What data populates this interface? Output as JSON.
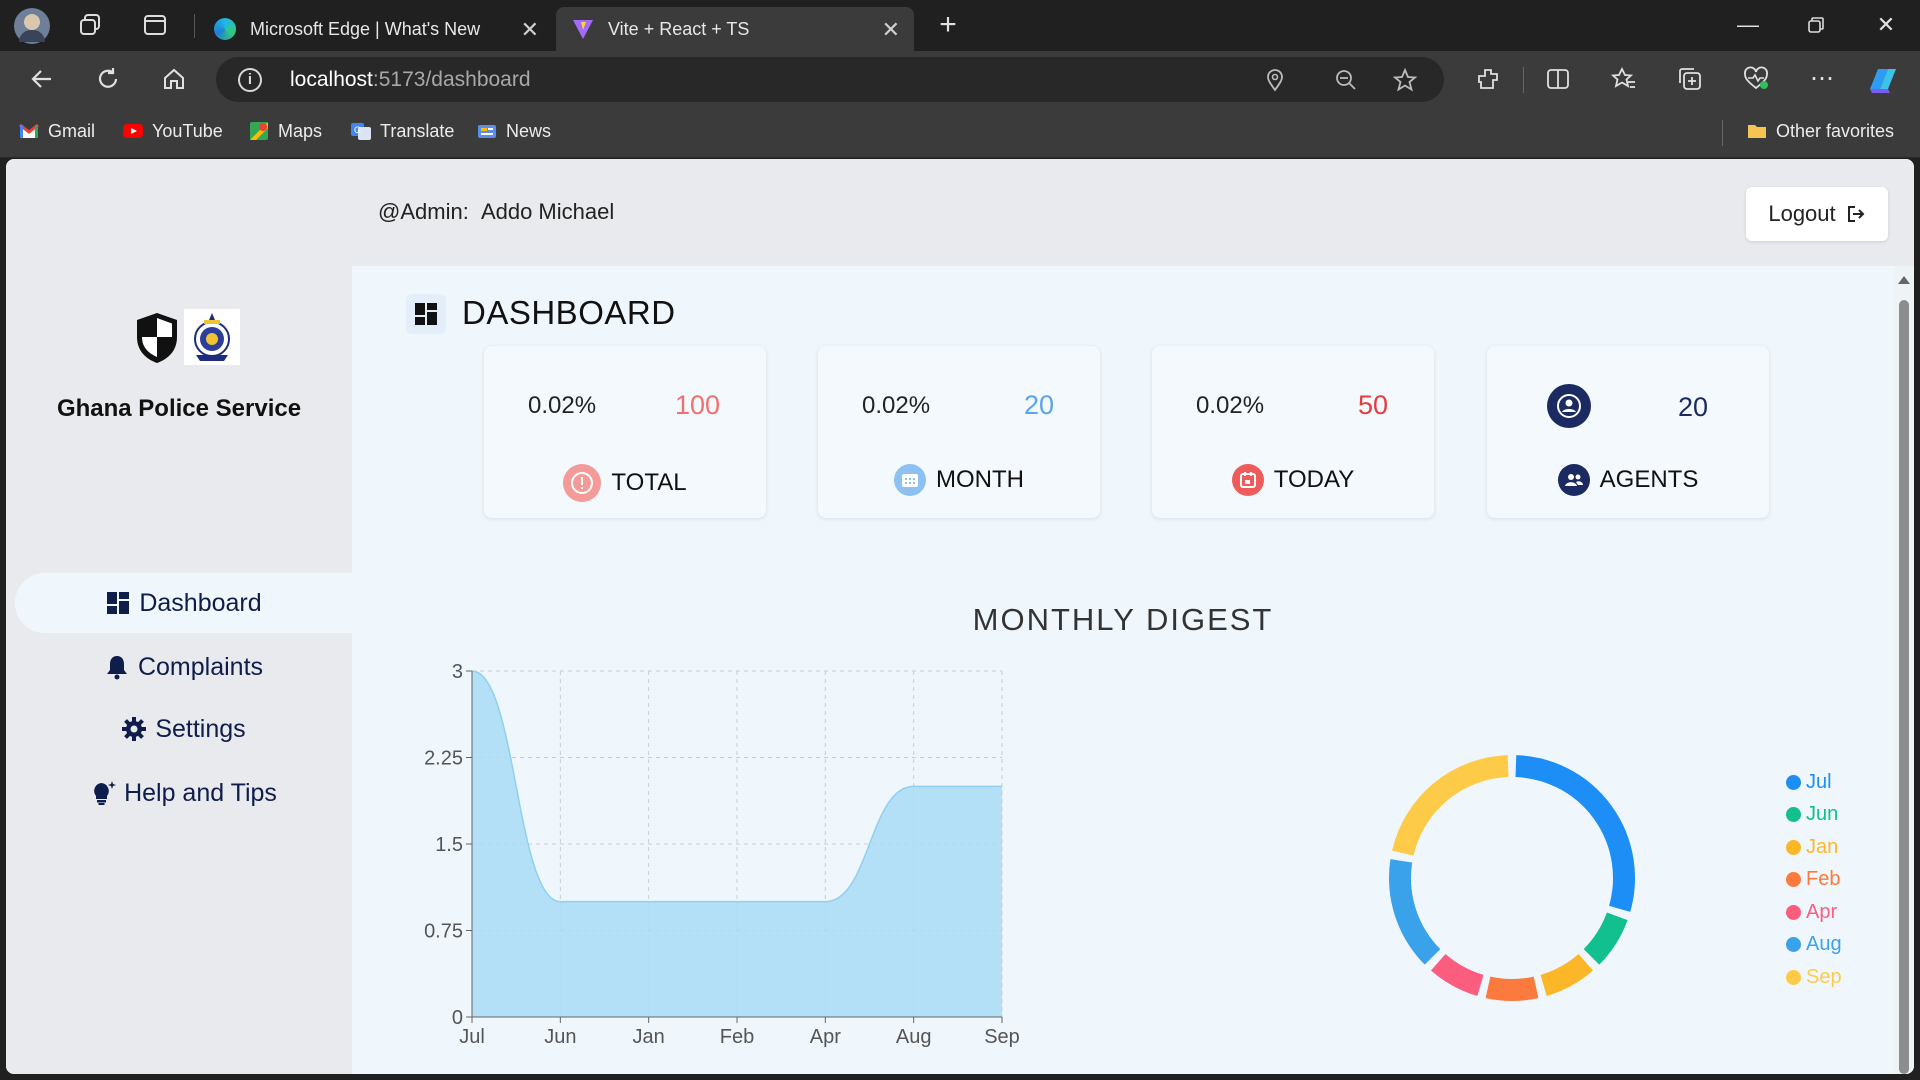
{
  "browser": {
    "tabs": [
      {
        "title": "Microsoft Edge | What's New",
        "active": false
      },
      {
        "title": "Vite + React + TS",
        "active": true
      }
    ],
    "address": {
      "host": "localhost",
      "path": ":5173/dashboard"
    },
    "favorites": [
      {
        "label": "Gmail",
        "icon": "gmail-icon",
        "color": "#ea4335"
      },
      {
        "label": "YouTube",
        "icon": "youtube-icon",
        "color": "#ff0000"
      },
      {
        "label": "Maps",
        "icon": "maps-icon",
        "color": "#34a853"
      },
      {
        "label": "Translate",
        "icon": "translate-icon",
        "color": "#4285f4"
      },
      {
        "label": "News",
        "icon": "news-icon",
        "color": "#5b8def"
      }
    ],
    "other_favorites": "Other favorites"
  },
  "sidebar": {
    "org_name": "Ghana Police Service",
    "items": [
      {
        "label": "Dashboard",
        "icon": "dashboard-icon",
        "active": true
      },
      {
        "label": "Complaints",
        "icon": "bell-icon",
        "active": false
      },
      {
        "label": "Settings",
        "icon": "gear-icon",
        "active": false
      },
      {
        "label": "Help and Tips",
        "icon": "lightbulb-icon",
        "active": false
      }
    ]
  },
  "topbar": {
    "admin_prefix": "@Admin:",
    "admin_name": "Addo Michael",
    "logout_label": "Logout"
  },
  "dashboard": {
    "title": "DASHBOARD",
    "cards": [
      {
        "percent": "0.02%",
        "count": "100",
        "label": "TOTAL",
        "icon": "alert-circle-icon",
        "count_color": "#f0706e",
        "icon_bg": "#f49a98"
      },
      {
        "percent": "0.02%",
        "count": "20",
        "label": "MONTH",
        "icon": "calendar-icon",
        "count_color": "#5aa4ea",
        "icon_bg": "#8ec1f2"
      },
      {
        "percent": "0.02%",
        "count": "50",
        "label": "TODAY",
        "icon": "calendar-day-icon",
        "count_color": "#e43c3c",
        "icon_bg": "#ef5a5a"
      },
      {
        "percent": "",
        "count": "20",
        "label": "AGENTS",
        "icon": "users-icon",
        "count_color": "#1b2a60",
        "icon_bg": "#1b2a60"
      }
    ],
    "digest_title": "MONTHLY DIGEST"
  },
  "chart_data": [
    {
      "type": "area",
      "title": "",
      "xlabel": "",
      "ylabel": "",
      "categories": [
        "Jul",
        "Jun",
        "Jan",
        "Feb",
        "Apr",
        "Aug",
        "Sep"
      ],
      "series": [
        {
          "values": [
            3,
            1,
            1,
            1,
            1,
            2,
            2
          ],
          "color": "#a8dcf6"
        }
      ],
      "yticks": [
        "0",
        "0.75",
        "1.5",
        "2.25",
        "3"
      ],
      "ylim": [
        0,
        3
      ],
      "grid": true
    },
    {
      "type": "pie",
      "donut": true,
      "categories": [
        "Jul",
        "Jun",
        "Jan",
        "Feb",
        "Apr",
        "Aug",
        "Sep"
      ],
      "values": [
        30,
        8,
        8,
        8,
        8,
        16,
        22
      ],
      "colors": [
        "#1c8ef5",
        "#12bf8f",
        "#fbb728",
        "#fb7a3d",
        "#fb5d7f",
        "#3aa2ea",
        "#fdcb47"
      ],
      "legend": "right"
    }
  ]
}
